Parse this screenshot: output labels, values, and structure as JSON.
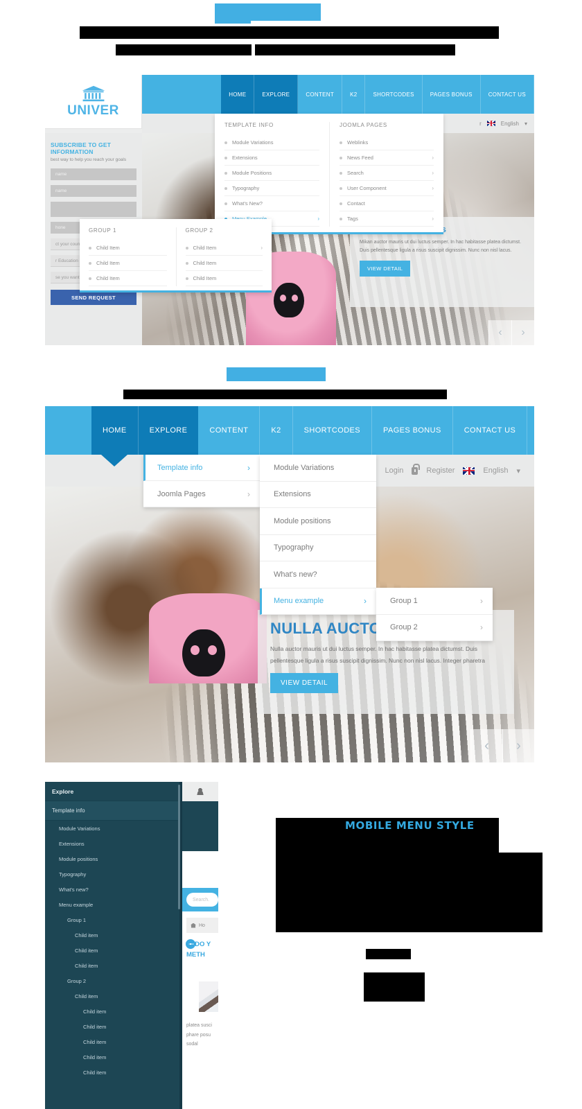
{
  "redactions": {
    "top_blue_box": {
      "label": "redacted-heading-highlight",
      "color": "#42afe3"
    },
    "bars": [
      {
        "name": "top-title-bar"
      },
      {
        "name": "top-subtitle-bar-left"
      },
      {
        "name": "top-subtitle-bar-right"
      },
      {
        "name": "section2-title-bar"
      },
      {
        "name": "section3-body-bar"
      },
      {
        "name": "section3-small-bar"
      },
      {
        "name": "section3-button-bar"
      }
    ]
  },
  "section1": {
    "logo": {
      "name": "UNIVER",
      "icon": "classical-building-icon"
    },
    "nav": [
      {
        "label": "HOME",
        "state": "active"
      },
      {
        "label": "EXPLORE",
        "state": "open"
      },
      {
        "label": "CONTENT",
        "state": "normal"
      },
      {
        "label": "K2",
        "state": "normal"
      },
      {
        "label": "SHORTCODES",
        "state": "normal"
      },
      {
        "label": "PAGES BONUS",
        "state": "normal"
      },
      {
        "label": "CONTACT US",
        "state": "normal"
      }
    ],
    "topbar": {
      "trailing": "r",
      "language": "English",
      "caret": "▾"
    },
    "mega": {
      "col1": {
        "title": "TEMPLATE INFO",
        "items": [
          {
            "label": "Module Variations",
            "arrow": ""
          },
          {
            "label": "Extensions",
            "arrow": ""
          },
          {
            "label": "Module Positions",
            "arrow": ""
          },
          {
            "label": "Typography",
            "arrow": ""
          },
          {
            "label": "What's New?",
            "arrow": ""
          },
          {
            "label": "Menu Example",
            "arrow": "›",
            "active": true
          }
        ]
      },
      "col2": {
        "title": "JOOMLA PAGES",
        "items": [
          {
            "label": "Weblinks",
            "arrow": ""
          },
          {
            "label": "News Feed",
            "arrow": "›"
          },
          {
            "label": "Search",
            "arrow": "›"
          },
          {
            "label": "User Component",
            "arrow": "›"
          },
          {
            "label": "Contact",
            "arrow": ""
          },
          {
            "label": "Tags",
            "arrow": "›"
          }
        ]
      }
    },
    "submenu": {
      "col1": {
        "title": "GROUP 1",
        "items": [
          {
            "label": "Child Item",
            "arrow": ""
          },
          {
            "label": "Child Item",
            "arrow": ""
          },
          {
            "label": "Child Item",
            "arrow": ""
          }
        ]
      },
      "col2": {
        "title": "GROUP 2",
        "items": [
          {
            "label": "Child Item",
            "arrow": "›"
          },
          {
            "label": "Child Item",
            "arrow": ""
          },
          {
            "label": "Child Item",
            "arrow": ""
          }
        ]
      }
    },
    "form": {
      "title": "SUBSCRIBE TO GET INFORMATION",
      "subtitle": "best way to help you reach your goals",
      "fields": [
        {
          "placeholder": "name"
        },
        {
          "placeholder": "name"
        },
        {
          "placeholder": ""
        },
        {
          "placeholder": "hone"
        }
      ],
      "selects": [
        {
          "value": "ct your country"
        },
        {
          "value": "r Education Level"
        },
        {
          "value": "se you want to l"
        }
      ],
      "submit": "SEND REQUEST"
    },
    "slide": {
      "title": "Pazen mikan mauris",
      "body": "Mikan auctor mauris ut dui luctus semper. In hac habitasse platea dictumst. Duis pellentesque ligula a risus suscipit dignissim. Nunc non nisl lacus.",
      "button": "VIEW DETAIL",
      "prev": "‹",
      "next": "›"
    }
  },
  "section2": {
    "nav": [
      {
        "label": "HOME",
        "state": "active"
      },
      {
        "label": "EXPLORE",
        "state": "open"
      },
      {
        "label": "CONTENT",
        "state": "normal"
      },
      {
        "label": "K2",
        "state": "normal"
      },
      {
        "label": "SHORTCODES",
        "state": "normal"
      },
      {
        "label": "PAGES BONUS",
        "state": "normal"
      },
      {
        "label": "CONTACT US",
        "state": "normal"
      }
    ],
    "topbar": {
      "login": "Login",
      "register": "Register",
      "language": "English",
      "caret": "▾"
    },
    "dropdown1": [
      {
        "label": "Template info",
        "arrow": "›",
        "active": true
      },
      {
        "label": "Joomla Pages",
        "arrow": "›",
        "active": false
      }
    ],
    "dropdown2": [
      {
        "label": "Module Variations",
        "arrow": "",
        "active": false
      },
      {
        "label": "Extensions",
        "arrow": "",
        "active": false
      },
      {
        "label": "Module positions",
        "arrow": "",
        "active": false
      },
      {
        "label": "Typography",
        "arrow": "",
        "active": false
      },
      {
        "label": "What's new?",
        "arrow": "",
        "active": false
      },
      {
        "label": "Menu example",
        "arrow": "›",
        "active": true
      }
    ],
    "dropdown3": [
      {
        "label": "Group 1",
        "arrow": "›"
      },
      {
        "label": "Group 2",
        "arrow": "›"
      }
    ],
    "slide": {
      "title": "NULLA AUCTOR",
      "body": "Nulla auctor mauris ut dui luctus semper. In hac habitasse platea dictumst. Duis pellentesque ligula a risus suscipit dignissim. Nunc non nisl lacus. Integer pharetra",
      "button": "VIEW DETAIL",
      "prev": "‹",
      "next": "›"
    }
  },
  "section3": {
    "heading": "MOBILE MENU STYLE",
    "sidebar": {
      "header": "Explore",
      "active": "Template info",
      "items": [
        {
          "label": "Module Variations",
          "level": 2
        },
        {
          "label": "Extensions",
          "level": 2
        },
        {
          "label": "Module positions",
          "level": 2
        },
        {
          "label": "Typography",
          "level": 2
        },
        {
          "label": "What's new?",
          "level": 2
        },
        {
          "label": "Menu example",
          "level": 2
        },
        {
          "label": "Group 1",
          "level": 3
        },
        {
          "label": "Child item",
          "level": 4
        },
        {
          "label": "Child item",
          "level": 4
        },
        {
          "label": "Child item",
          "level": 4
        },
        {
          "label": "Group 2",
          "level": 3
        },
        {
          "label": "Child item",
          "level": 4
        },
        {
          "label": "Child item",
          "level": 5
        },
        {
          "label": "Child item",
          "level": 5
        },
        {
          "label": "Child item",
          "level": 5
        },
        {
          "label": "Child item",
          "level": 5
        },
        {
          "label": "Child item",
          "level": 5
        }
      ]
    },
    "content": {
      "search_placeholder": "Search.",
      "breadcrumb": "Ho",
      "headline": "ID\nDO Y\nMETH",
      "body_lines": "platea\nsusci\nphare\nposu\nsodal"
    }
  },
  "colors": {
    "brand_blue": "#44b2e2",
    "brand_blue_dark": "#0e7cb7",
    "sidebar_teal": "#1d4654",
    "heading_blue": "#34a9e0",
    "submit_blue": "#3a63ad",
    "redact_black": "#000000"
  }
}
